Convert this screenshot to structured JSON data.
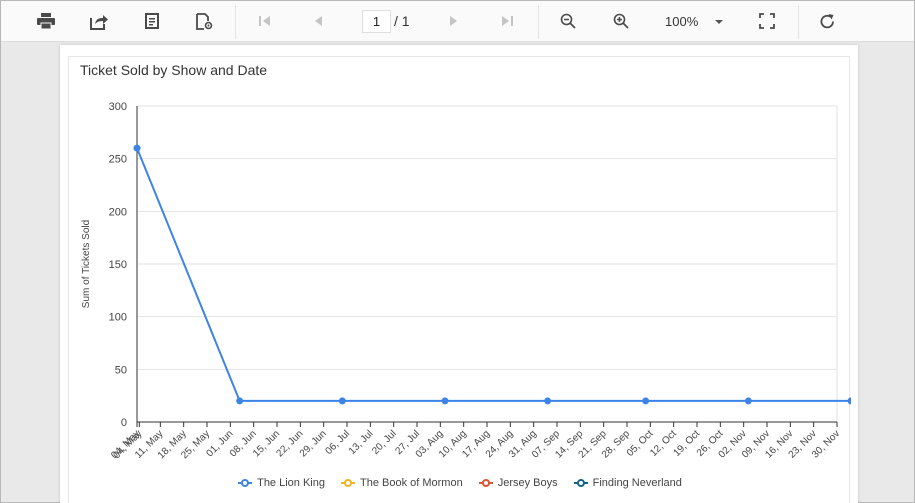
{
  "toolbar": {
    "icons": [
      "print-icon",
      "export-icon",
      "document-icon",
      "page-setup-icon",
      "first-page-icon",
      "previous-page-icon",
      "next-page-icon",
      "last-page-icon",
      "zoom-out-icon",
      "zoom-in-icon",
      "fullscreen-icon",
      "refresh-icon"
    ],
    "page_current": "1",
    "page_total": "/ 1",
    "zoom": "100%"
  },
  "colors": {
    "series1": "#3d84e6",
    "series2": "#f5b125",
    "series3": "#e0532f",
    "series4": "#116482",
    "grid": "#e2e2e2",
    "axis": "#333333"
  },
  "chart_data": {
    "type": "line",
    "title": "Ticket Sold by Show and Date",
    "ylabel": "Sum of Tickets Sold",
    "xlabel": "",
    "ylim": [
      0,
      300
    ],
    "yticks": [
      "0",
      "50",
      "100",
      "150",
      "200",
      "250",
      "300"
    ],
    "categories": [
      "04, May",
      "11, May",
      "18, May",
      "25, May",
      "01, Jun",
      "08, Jun",
      "15, Jun",
      "22, Jun",
      "29, Jun",
      "06, Jul",
      "13, Jul",
      "20, Jul",
      "27, Jul",
      "03, Aug",
      "10, Aug",
      "17, Aug",
      "24, Aug",
      "31, Aug",
      "07, Sep",
      "14, Sep",
      "21, Sep",
      "28, Sep",
      "05, Oct",
      "12, Oct",
      "19, Oct",
      "26, Oct",
      "02, Nov",
      "09, Nov",
      "16, Nov",
      "23, Nov",
      "30, Nov"
    ],
    "extra_tick_label": "04, May",
    "series": [
      {
        "name": "The Lion King",
        "x_index": [
          0,
          4.4,
          8.8,
          13.2,
          17.6,
          21.8,
          26.2,
          30.6
        ],
        "values": [
          260,
          20,
          20,
          20,
          20,
          20,
          20,
          20
        ]
      }
    ],
    "legend": [
      "The Lion King",
      "The Book of Mormon",
      "Jersey Boys",
      "Finding Neverland"
    ],
    "legend_position": "bottom",
    "grid": true
  }
}
